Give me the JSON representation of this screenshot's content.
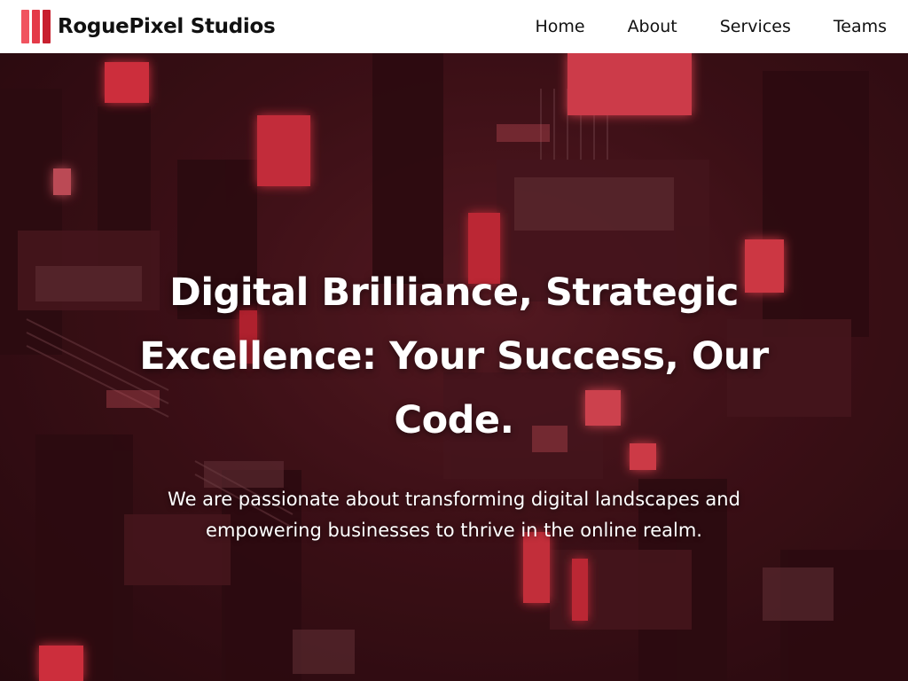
{
  "brand": {
    "name": "RoguePixel Studios",
    "logo_icon": "three-red-bars-logo-icon"
  },
  "nav": {
    "items": [
      {
        "label": "Home"
      },
      {
        "label": "About"
      },
      {
        "label": "Services"
      },
      {
        "label": "Teams"
      }
    ]
  },
  "hero": {
    "title": "Digital Brilliance, Strategic Excellence: Your Success, Our Code.",
    "subtitle": "We are passionate about transforming digital landscapes and empowering businesses to thrive in the online realm.",
    "background": "isometric-red-circuit-city-image"
  },
  "colors": {
    "accent": "#e43a48",
    "nav_bg": "#ffffff",
    "hero_text": "#ffffff"
  }
}
